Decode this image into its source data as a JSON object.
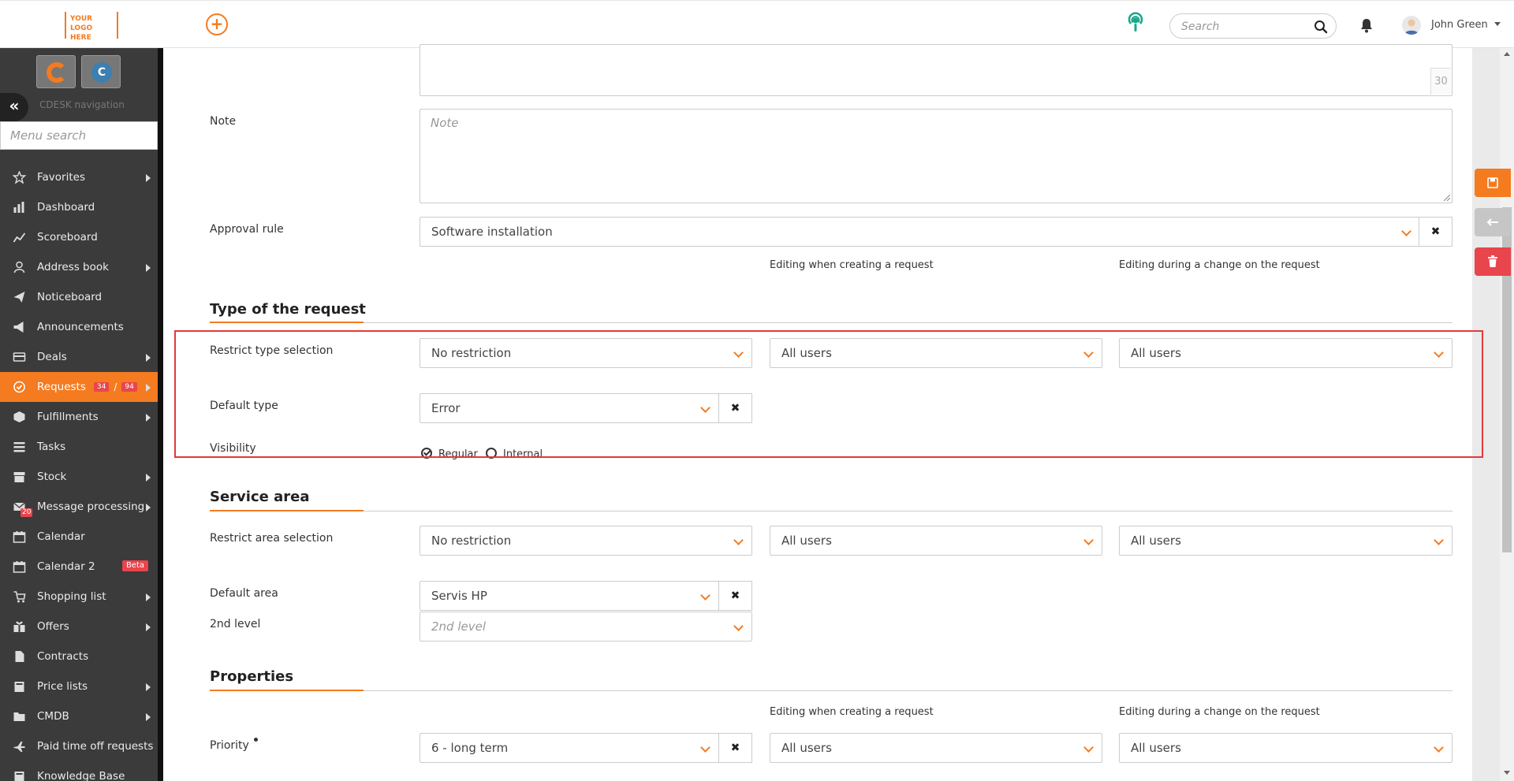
{
  "header": {
    "logo_line1": "YOUR LOGO",
    "logo_line2": "HERE",
    "search_placeholder": "Search",
    "user_name": "John Green"
  },
  "sidebar": {
    "nav_caption": "CDESK navigation",
    "menu_search_placeholder": "Menu search",
    "items": [
      {
        "label": "Favorites",
        "icon": "star-icon",
        "has_arrow": true
      },
      {
        "label": "Dashboard",
        "icon": "bar-chart-icon",
        "has_arrow": false
      },
      {
        "label": "Scoreboard",
        "icon": "line-chart-icon",
        "has_arrow": false
      },
      {
        "label": "Address book",
        "icon": "person-icon",
        "has_arrow": true
      },
      {
        "label": "Noticeboard",
        "icon": "paper-plane-icon",
        "has_arrow": false
      },
      {
        "label": "Announcements",
        "icon": "megaphone-icon",
        "has_arrow": false
      },
      {
        "label": "Deals",
        "icon": "credit-card-icon",
        "has_arrow": true
      },
      {
        "label": "Requests",
        "icon": "check-circle-icon",
        "has_arrow": true,
        "active": true,
        "badge_a": "34",
        "badge_sep": "/",
        "badge_b": "94"
      },
      {
        "label": "Fulfillments",
        "icon": "cube-icon",
        "has_arrow": true
      },
      {
        "label": "Tasks",
        "icon": "list-icon",
        "has_arrow": false
      },
      {
        "label": "Stock",
        "icon": "archive-icon",
        "has_arrow": true
      },
      {
        "label": "Message processing",
        "icon": "envelope-icon",
        "has_arrow": true,
        "count": "20"
      },
      {
        "label": "Calendar",
        "icon": "calendar-icon",
        "has_arrow": false
      },
      {
        "label": "Calendar 2",
        "icon": "calendar-icon",
        "has_arrow": false,
        "beta": "Beta"
      },
      {
        "label": "Shopping list",
        "icon": "cart-icon",
        "has_arrow": true
      },
      {
        "label": "Offers",
        "icon": "gift-icon",
        "has_arrow": true
      },
      {
        "label": "Contracts",
        "icon": "document-icon",
        "has_arrow": false
      },
      {
        "label": "Price lists",
        "icon": "book-icon",
        "has_arrow": true
      },
      {
        "label": "CMDB",
        "icon": "folder-icon",
        "has_arrow": true
      },
      {
        "label": "Paid time off requests",
        "icon": "plane-icon",
        "has_arrow": false
      },
      {
        "label": "Knowledge Base",
        "icon": "book-icon",
        "has_arrow": false
      }
    ]
  },
  "form": {
    "top_textarea_counter": "30",
    "note": {
      "label": "Note",
      "placeholder": "Note"
    },
    "approval_rule": {
      "label": "Approval rule",
      "value": "Software installation"
    },
    "col_head_create": "Editing when creating a request",
    "col_head_change": "Editing during a change on the request",
    "type_section": {
      "title": "Type of the request",
      "restrict": {
        "label": "Restrict type selection",
        "value": "No restriction",
        "create": "All users",
        "change": "All users"
      },
      "default": {
        "label": "Default type",
        "value": "Error"
      },
      "visibility": {
        "label": "Visibility",
        "opt_regular": "Regular",
        "opt_internal": "Internal",
        "selected": "Regular"
      }
    },
    "area_section": {
      "title": "Service area",
      "restrict": {
        "label": "Restrict area selection",
        "value": "No restriction",
        "create": "All users",
        "change": "All users"
      },
      "default": {
        "label": "Default area",
        "value": "Servis HP"
      },
      "level2": {
        "label": "2nd level",
        "placeholder": "2nd level"
      }
    },
    "properties_section": {
      "title": "Properties",
      "priority": {
        "label": "Priority",
        "value": "6 - long term",
        "create": "All users",
        "change": "All users"
      }
    }
  },
  "colors": {
    "accent": "#f47b20",
    "sidebar_bg": "#3b3b3b",
    "danger": "#e8454d",
    "highlight": "#e23a3a"
  }
}
